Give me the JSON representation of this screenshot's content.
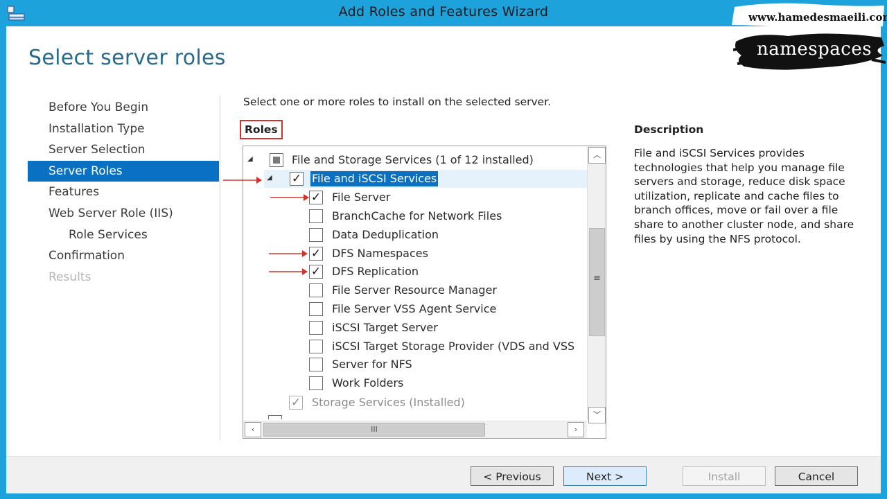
{
  "window": {
    "title": "Add Roles and Features Wizard"
  },
  "page": {
    "title": "Select server roles",
    "instructions": "Select one or more roles to install on the selected server.",
    "roles_label": "Roles"
  },
  "nav": {
    "items": [
      {
        "label": "Before You Begin",
        "state": "normal"
      },
      {
        "label": "Installation Type",
        "state": "normal"
      },
      {
        "label": "Server Selection",
        "state": "normal"
      },
      {
        "label": "Server Roles",
        "state": "active"
      },
      {
        "label": "Features",
        "state": "normal"
      },
      {
        "label": "Web Server Role (IIS)",
        "state": "normal"
      },
      {
        "label": "Role Services",
        "state": "sub"
      },
      {
        "label": "Confirmation",
        "state": "normal"
      },
      {
        "label": "Results",
        "state": "disabled"
      }
    ]
  },
  "roles_tree": [
    {
      "label": "File and Storage Services (1 of 12 installed)",
      "checked": "partial",
      "expanded": true,
      "level": 0
    },
    {
      "label": "File and iSCSI Services",
      "checked": true,
      "expanded": true,
      "level": 1,
      "selected": true
    },
    {
      "label": "File Server",
      "checked": true,
      "level": 2
    },
    {
      "label": "BranchCache for Network Files",
      "checked": false,
      "level": 2
    },
    {
      "label": "Data Deduplication",
      "checked": false,
      "level": 2
    },
    {
      "label": "DFS Namespaces",
      "checked": true,
      "level": 2
    },
    {
      "label": "DFS Replication",
      "checked": true,
      "level": 2
    },
    {
      "label": "File Server Resource Manager",
      "checked": false,
      "level": 2
    },
    {
      "label": "File Server VSS Agent Service",
      "checked": false,
      "level": 2
    },
    {
      "label": "iSCSI Target Server",
      "checked": false,
      "level": 2
    },
    {
      "label": "iSCSI Target Storage Provider (VDS and VSS",
      "checked": false,
      "level": 2
    },
    {
      "label": "Server for NFS",
      "checked": false,
      "level": 2
    },
    {
      "label": "Work Folders",
      "checked": false,
      "level": 2
    },
    {
      "label": "Storage Services (Installed)",
      "checked": "disabled",
      "level": 1
    }
  ],
  "description": {
    "heading": "Description",
    "text": "File and iSCSI Services provides technologies that help you manage file servers and storage, reduce disk space utilization, replicate and cache files to branch offices, move or fail over a file share to another cluster node, and share files by using the NFS protocol."
  },
  "buttons": {
    "previous": "< Previous",
    "next": "Next >",
    "install": "Install",
    "cancel": "Cancel"
  },
  "watermark": {
    "url": "www.hamedesmaeili.com",
    "word": "namespaces"
  },
  "colors": {
    "title_bar": "#1ea2dc",
    "nav_active": "#0a71c2",
    "page_title": "#2a6b8c",
    "annotation_red": "#d0342c"
  },
  "icons": {
    "app": "server-manager-icon",
    "expander": "triangle-expander-icon",
    "scroll_up": "chevron-up-icon",
    "scroll_down": "chevron-down-icon",
    "scroll_left": "chevron-left-icon",
    "scroll_right": "chevron-right-icon"
  }
}
